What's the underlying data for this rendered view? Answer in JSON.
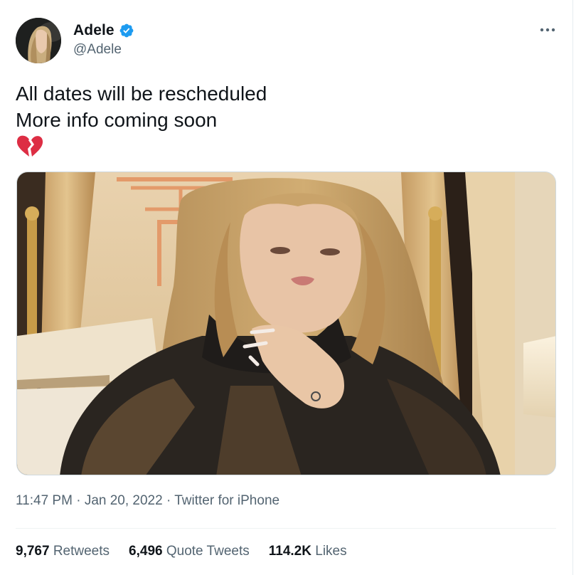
{
  "author": {
    "display_name": "Adele",
    "handle": "@Adele",
    "verified_icon": "verified-badge-icon",
    "badge_color": "#1d9bf0"
  },
  "tweet": {
    "lines": [
      "All dates will be rescheduled",
      "More info coming soon"
    ],
    "emoji": "💔",
    "emoji_name": "broken-heart-icon"
  },
  "media": {
    "type": "video-still"
  },
  "meta": {
    "time": "11:47 PM",
    "date": "Jan 20, 2022",
    "separator": "·",
    "source": "Twitter for iPhone"
  },
  "stats": {
    "retweets_count": "9,767",
    "retweets_label": "Retweets",
    "quotes_count": "6,496",
    "quotes_label": "Quote Tweets",
    "likes_count": "114.2K",
    "likes_label": "Likes"
  },
  "colors": {
    "text_primary": "#0f1419",
    "text_secondary": "#536471",
    "border": "#eff3f4"
  }
}
